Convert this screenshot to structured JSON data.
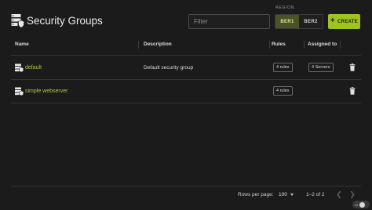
{
  "header": {
    "title": "Security Groups",
    "title_icon": "server-shield-icon",
    "filter_placeholder": "Filter",
    "filter_value": "",
    "region_label": "REGION",
    "regions": [
      {
        "label": "BER1",
        "active": true
      },
      {
        "label": "BER2",
        "active": false
      }
    ],
    "create_label": "CREATE"
  },
  "table": {
    "columns": [
      "Name",
      "Description",
      "Rules",
      "Assigned to"
    ],
    "rows": [
      {
        "name": "default",
        "description": "Default security group",
        "rules": "4 rules",
        "assigned": "4 Servers"
      },
      {
        "name": "simple webserver",
        "description": "",
        "rules": "4 rules",
        "assigned": ""
      }
    ]
  },
  "footer": {
    "rows_per_page_label": "Rows per page:",
    "rows_per_page_value": "100",
    "range_text": "1–2 of 2"
  },
  "corner_badge": "Lit",
  "colors": {
    "accent": "#9ec41d",
    "link": "#a9c84a",
    "active_region_bg": "#4c5224",
    "background": "#1b1b1b"
  }
}
